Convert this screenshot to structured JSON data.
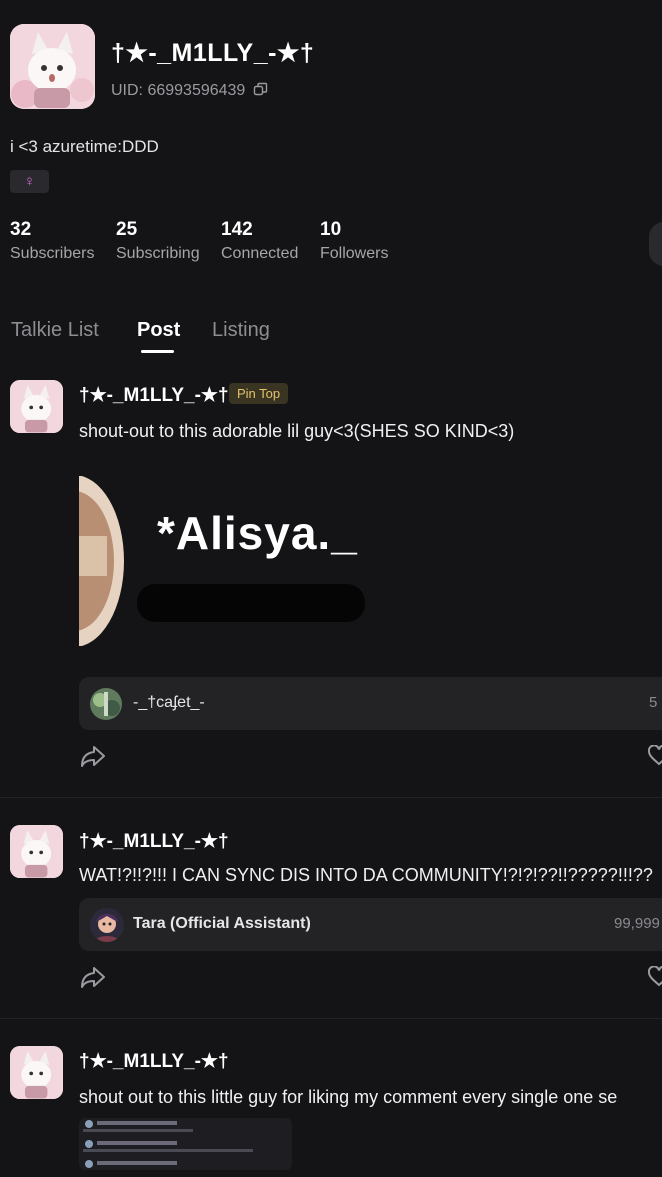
{
  "profile": {
    "username": "†★-_M1LLY_-★†",
    "uid": "UID: 66993596439",
    "bio": "i <3 azuretime:DDD",
    "gender_symbol": "♀"
  },
  "stats": [
    {
      "value": "32",
      "label": "Subscribers"
    },
    {
      "value": "25",
      "label": "Subscribing"
    },
    {
      "value": "142",
      "label": "Connected"
    },
    {
      "value": "10",
      "label": "Followers"
    }
  ],
  "tabs": [
    "Talkie List",
    "Post",
    "Listing"
  ],
  "active_tab": "Post",
  "posts": [
    {
      "author": "†★-_M1LLY_-★†",
      "badge": "Pin Top",
      "text": "shout-out to this adorable lil guy<3(SHES SO KIND<3)",
      "image_text": "*Alisya._",
      "linked_name": "-_†caʄet_-",
      "linked_count": "5"
    },
    {
      "author": "†★-_M1LLY_-★†",
      "text": "WAT!?!!?!!! I CAN SYNC DIS INTO DA COMMUNITY!?!?!??!!?????!!!??",
      "linked_name": "Tara (Official Assistant)",
      "linked_count": "99,999"
    },
    {
      "author": "†★-_M1LLY_-★†",
      "text": "shout out to this little guy for liking my comment every single one se"
    }
  ],
  "icons": {
    "copy": "copy-icon",
    "share": "share-icon",
    "heart": "heart-icon"
  },
  "colors": {
    "background": "#141416",
    "pin_badge_text": "#e2c46a",
    "gender": "#d66bd2"
  }
}
